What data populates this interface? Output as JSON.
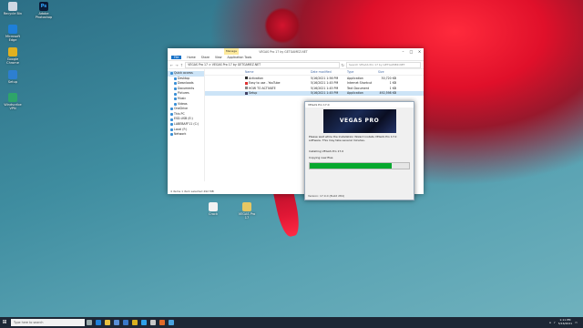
{
  "desktop": {
    "icons": [
      {
        "label": "Recycle Bin",
        "color": "#cfd8e3"
      },
      {
        "label": "Microsoft Edge",
        "color": "#1e7fd8"
      },
      {
        "label": "Google Chrome",
        "color": "#e0b020"
      },
      {
        "label": "Setup",
        "color": "#2d7fd0"
      },
      {
        "label": "Windscribe VPN",
        "color": "#2ea56a"
      }
    ],
    "ps_icon": {
      "label": "Adobe Photoshop",
      "color": "#0a1a36",
      "glyph": "Ps"
    },
    "center_icons": [
      {
        "label": "Crack",
        "color": "#f2f2f2"
      },
      {
        "label": "VEGAS Pro 17",
        "color": "#e7c763"
      }
    ]
  },
  "explorer": {
    "title": "VEGAS Pro 17 by GETGAMEZ.NET",
    "manage_label": "Manage",
    "ribbon_tabs": [
      "File",
      "Home",
      "Share",
      "View",
      "Application Tools"
    ],
    "active_tab": "File",
    "path": "VEGAS Pro 17  >  VEGAS Pro 17 by GETGAMEZ.NET",
    "search_placeholder": "Search VEGAS Pro 17 by GETGAMEZ.NET",
    "nav_items": [
      {
        "label": "Quick access",
        "sel": true,
        "sub": false
      },
      {
        "label": "Desktop",
        "sel": false,
        "sub": true
      },
      {
        "label": "Downloads",
        "sel": false,
        "sub": true
      },
      {
        "label": "Documents",
        "sel": false,
        "sub": true
      },
      {
        "label": "Pictures",
        "sel": false,
        "sub": true
      },
      {
        "label": "Music",
        "sel": false,
        "sub": true
      },
      {
        "label": "Videos",
        "sel": false,
        "sub": true
      },
      {
        "label": "OneDrive",
        "sel": false,
        "sub": false
      },
      {
        "label": "This PC",
        "sel": false,
        "sub": false
      },
      {
        "label": "ESD-USB (E:)",
        "sel": false,
        "sub": false
      },
      {
        "label": "LABEBAFF11 (C:)",
        "sel": false,
        "sub": false
      },
      {
        "label": "Local (F:)",
        "sel": false,
        "sub": false
      },
      {
        "label": "Network",
        "sel": false,
        "sub": false
      }
    ],
    "columns": [
      "Name",
      "Date modified",
      "Type",
      "Size"
    ],
    "files": [
      {
        "name": "Activation",
        "date": "5/16/2021 1:56 PM",
        "type": "Application",
        "size": "30,720 KB",
        "sel": false,
        "color": "#333"
      },
      {
        "name": "Easy to use - YouTube",
        "date": "5/16/2021 1:45 PM",
        "type": "Internet Shortcut",
        "size": "1 KB",
        "sel": false,
        "color": "#d33"
      },
      {
        "name": "HOW TO ACTIVATE",
        "date": "5/16/2021 1:45 PM",
        "type": "Text Document",
        "size": "1 KB",
        "sel": false,
        "color": "#888"
      },
      {
        "name": "Setup",
        "date": "5/16/2021 1:45 PM",
        "type": "Application",
        "size": "492,598 KB",
        "sel": true,
        "color": "#446"
      }
    ],
    "status": "4 items    1 item selected  492 MB"
  },
  "installer": {
    "title": "VEGAS Pro 17.0",
    "banner": "VEGAS PRO",
    "message": "Please wait while the Installation Wizard installs VEGAS Pro 17.0 software. This may take several minutes.",
    "installing": "Installing VEGAS Pro 17.0",
    "step": "Copying new files",
    "progress": 0.83,
    "version": "Version: 17.0.0 (Build 284)"
  },
  "taskbar": {
    "start_glyph": "⊞",
    "search_placeholder": "Type here to search",
    "apps": [
      {
        "name": "task-view-icon",
        "color": "#9aa"
      },
      {
        "name": "edge-icon",
        "color": "#1e7fd8"
      },
      {
        "name": "file-explorer-icon",
        "color": "#e7c040"
      },
      {
        "name": "store-icon",
        "color": "#5a8fd6"
      },
      {
        "name": "mail-icon",
        "color": "#3a78c8"
      },
      {
        "name": "chrome-icon",
        "color": "#d9b01f"
      },
      {
        "name": "photoshop-icon",
        "color": "#2ea0e8"
      },
      {
        "name": "vegas-icon",
        "color": "#c7c7c7"
      },
      {
        "name": "media-player-icon",
        "color": "#e06a2a"
      },
      {
        "name": "setup-icon",
        "color": "#4aa3df"
      }
    ],
    "time": "1:11 PM",
    "date": "5/16/2021"
  }
}
